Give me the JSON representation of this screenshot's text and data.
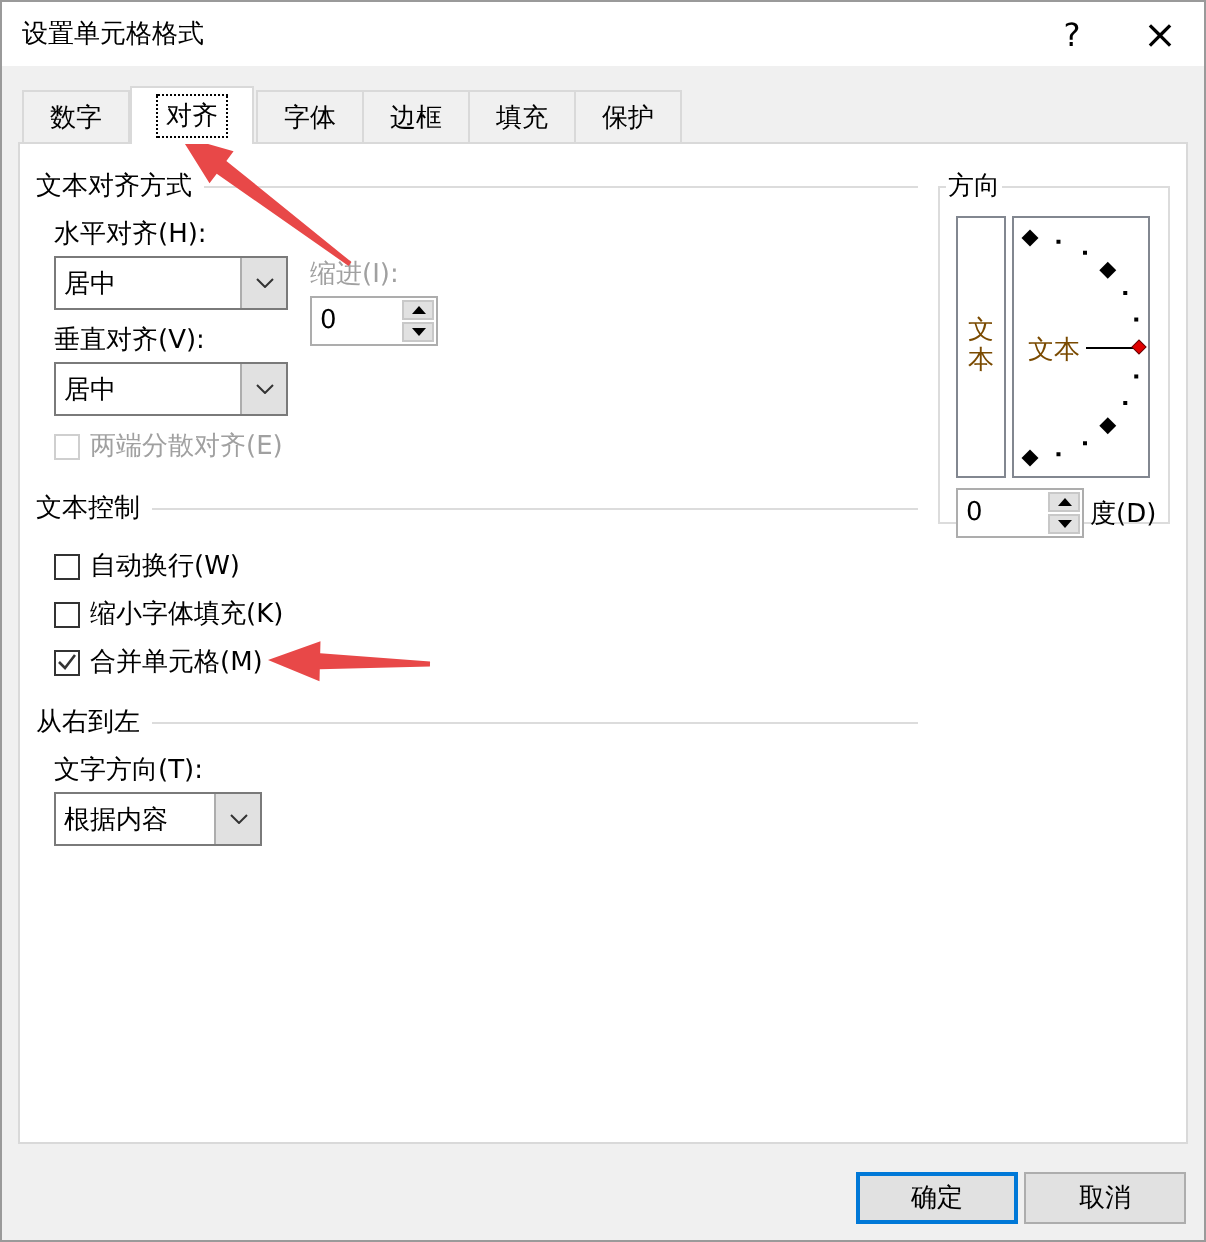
{
  "window": {
    "title": "设置单元格格式",
    "help": "?",
    "close": "×"
  },
  "tabs": [
    {
      "label": "数字",
      "selected": false
    },
    {
      "label": "对齐",
      "selected": true
    },
    {
      "label": "字体",
      "selected": false
    },
    {
      "label": "边框",
      "selected": false
    },
    {
      "label": "填充",
      "selected": false
    },
    {
      "label": "保护",
      "selected": false
    }
  ],
  "alignment": {
    "title": "文本对齐方式",
    "horizontal": {
      "label": "水平对齐(H):",
      "value": "居中"
    },
    "indent": {
      "label": "缩进(I):",
      "value": "0",
      "disabled": true
    },
    "vertical": {
      "label": "垂直对齐(V):",
      "value": "居中"
    },
    "distributed": {
      "label": "两端分散对齐(E)",
      "checked": false,
      "disabled": true
    }
  },
  "text_control": {
    "title": "文本控制",
    "options": [
      {
        "label": "自动换行(W)",
        "checked": false
      },
      {
        "label": "缩小字体填充(K)",
        "checked": false
      },
      {
        "label": "合并单元格(M)",
        "checked": true
      }
    ]
  },
  "right_to_left": {
    "title": "从右到左",
    "direction": {
      "label": "文字方向(T):",
      "value": "根据内容"
    }
  },
  "orientation": {
    "title": "方向",
    "vertical_text": "文本",
    "dial_text": "文本",
    "degrees": {
      "value": "0",
      "label": "度(D)"
    }
  },
  "buttons": [
    {
      "label": "确定",
      "default": true
    },
    {
      "label": "取消",
      "default": false
    }
  ]
}
